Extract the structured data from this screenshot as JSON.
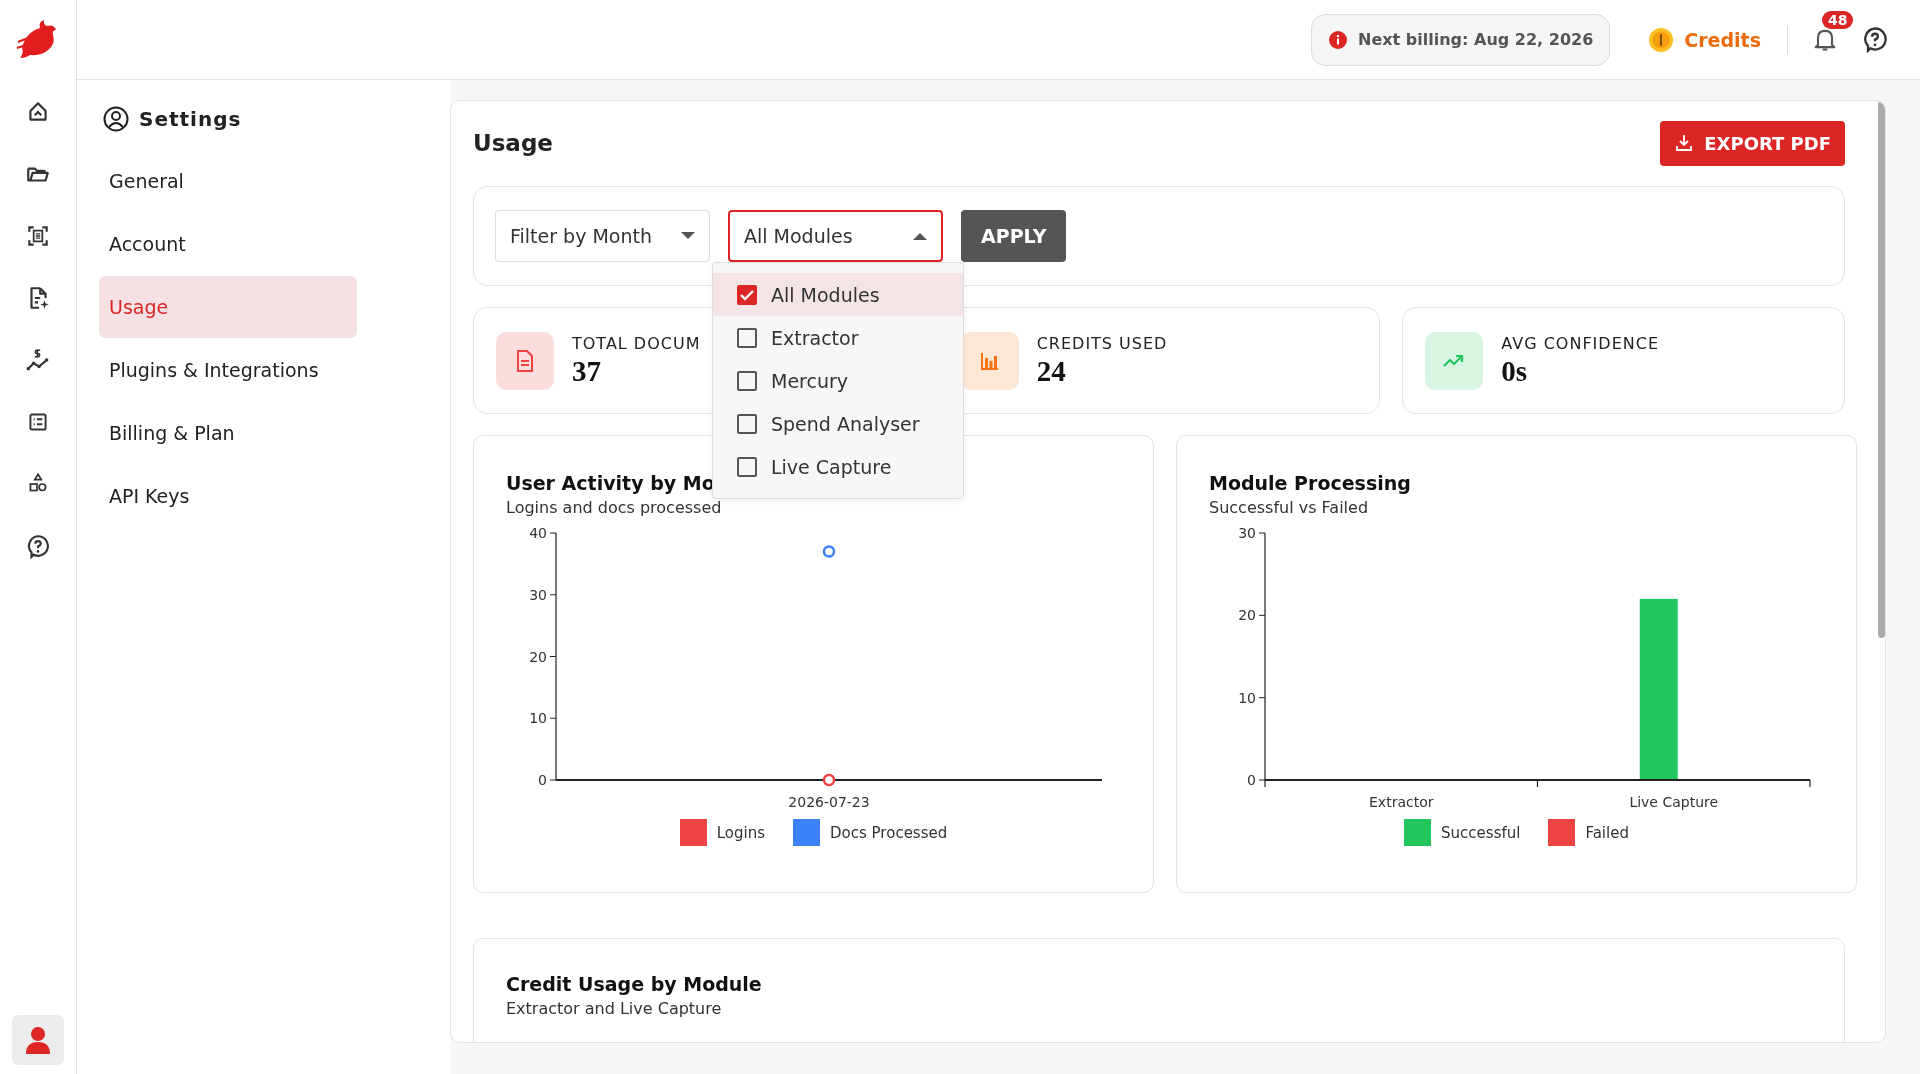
{
  "top_bar": {
    "billing_notice": "Next billing: Aug 22, 2026",
    "credits_label": "Credits",
    "notification_count": "48"
  },
  "settings": {
    "title": "Settings",
    "items": [
      {
        "label": "General",
        "selected": false
      },
      {
        "label": "Account",
        "selected": false
      },
      {
        "label": "Usage",
        "selected": true
      },
      {
        "label": "Plugins & Integrations",
        "selected": false
      },
      {
        "label": "Billing & Plan",
        "selected": false
      },
      {
        "label": "API Keys",
        "selected": false
      }
    ]
  },
  "usage": {
    "title": "Usage",
    "export_button": "EXPORT PDF",
    "filters": {
      "month_select": {
        "value": "Filter by Month"
      },
      "module_select": {
        "value": "All Modules",
        "expanded": true
      },
      "apply_button": "APPLY"
    },
    "module_options": [
      {
        "label": "All Modules",
        "checked": true,
        "selected": true
      },
      {
        "label": "Extractor",
        "checked": false,
        "selected": false
      },
      {
        "label": "Mercury",
        "checked": false,
        "selected": false
      },
      {
        "label": "Spend Analyser",
        "checked": false,
        "selected": false
      },
      {
        "label": "Live Capture",
        "checked": false,
        "selected": false
      }
    ],
    "stats": [
      {
        "kind": "documents",
        "label": "TOTAL DOCUM",
        "value": "37",
        "color": "#ef4444"
      },
      {
        "kind": "credits",
        "label": "CREDITS USED",
        "value": "24",
        "color": "#f97316"
      },
      {
        "kind": "trend",
        "label": "AVG CONFIDENCE",
        "value": "0s",
        "color": "#22c55e"
      }
    ],
    "activity_chart": {
      "title": "User Activity by Mo",
      "subtitle": "Logins and docs processed",
      "chart_data": {
        "type": "line",
        "categories": [
          "2026-07-23"
        ],
        "series": [
          {
            "name": "Logins",
            "color": "#ef4444",
            "values": [
              0
            ],
            "marker": "circle"
          },
          {
            "name": "Docs Processed",
            "color": "#3b82f6",
            "values": [
              37
            ],
            "marker": "circle"
          }
        ],
        "ylim": [
          0,
          40
        ],
        "yticks": [
          0,
          10,
          20,
          30,
          40
        ]
      }
    },
    "processing_chart": {
      "title": "Module Processing",
      "subtitle": "Successful vs Failed",
      "chart_data": {
        "type": "bar",
        "categories": [
          "Extractor",
          "Live Capture"
        ],
        "series": [
          {
            "name": "Successful",
            "color": "#22c55e",
            "values": [
              0,
              22
            ]
          },
          {
            "name": "Failed",
            "color": "#ef4444",
            "values": [
              0,
              0
            ]
          }
        ],
        "ylim": [
          0,
          30
        ],
        "yticks": [
          0,
          10,
          20,
          30
        ]
      }
    },
    "credit_chart": {
      "title": "Credit Usage by Module",
      "subtitle": "Extractor and Live Capture"
    }
  }
}
